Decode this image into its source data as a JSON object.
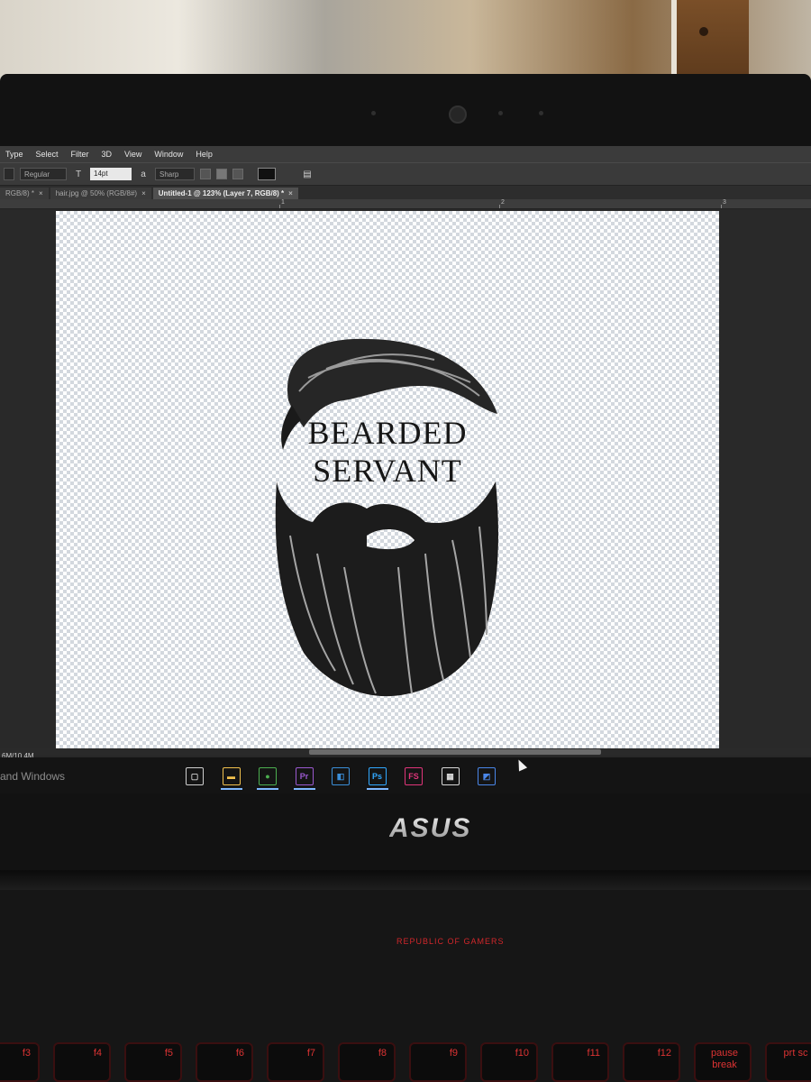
{
  "menubar": {
    "items": [
      "Type",
      "Select",
      "Filter",
      "3D",
      "View",
      "Window",
      "Help"
    ]
  },
  "options": {
    "font_style": "Regular",
    "font_size": "14pt",
    "antialias": "Sharp"
  },
  "tabs": [
    {
      "label": "RGB/8) *",
      "active": false
    },
    {
      "label": "hair.jpg @ 50% (RGB/8#)",
      "active": false
    },
    {
      "label": "Untitled-1 @ 123% (Layer 7, RGB/8) *",
      "active": true
    }
  ],
  "ruler": {
    "marks": [
      "1",
      "2",
      "3"
    ]
  },
  "canvas": {
    "logo_line1": "BEARDED",
    "logo_line2": "SERVANT"
  },
  "status": {
    "doc_size": "6M/10.4M"
  },
  "taskbar": {
    "search_text": "and Windows",
    "apps": [
      {
        "icon": "task-view-icon",
        "glyph": "▢",
        "color": "#cfcfcf",
        "running": false
      },
      {
        "icon": "file-explorer-icon",
        "glyph": "▬",
        "color": "#f2c14e",
        "running": true
      },
      {
        "icon": "chrome-icon",
        "glyph": "●",
        "color": "#4caf50",
        "running": true
      },
      {
        "icon": "premiere-icon",
        "glyph": "Pr",
        "color": "#9b59d0",
        "running": true
      },
      {
        "icon": "camera-app-icon",
        "glyph": "◧",
        "color": "#3b8fd9",
        "running": false
      },
      {
        "icon": "photoshop-icon",
        "glyph": "Ps",
        "color": "#31a8ff",
        "running": true
      },
      {
        "icon": "fs-app-icon",
        "glyph": "FS",
        "color": "#e0357a",
        "running": false
      },
      {
        "icon": "calculator-icon",
        "glyph": "▦",
        "color": "#d9d9d9",
        "running": false
      },
      {
        "icon": "paint-app-icon",
        "glyph": "◩",
        "color": "#4a86e8",
        "running": false
      }
    ]
  },
  "brand": {
    "bezel_logo": "ASUS",
    "deck_text": "REPUBLIC OF GAMERS"
  },
  "keyboard": {
    "keys": [
      "f3",
      "f4",
      "f5",
      "f6",
      "f7",
      "f8",
      "f9",
      "f10",
      "f11",
      "f12",
      "pause break",
      "prt sc"
    ]
  }
}
